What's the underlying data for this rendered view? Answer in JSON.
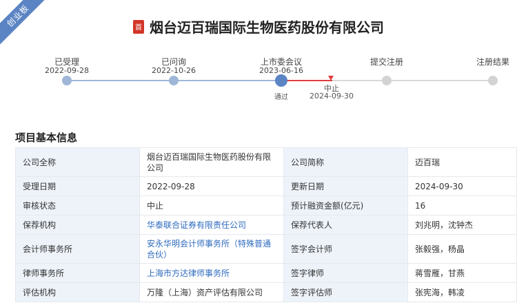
{
  "ribbon": "创业板",
  "header": {
    "badge": "首",
    "company_name": "烟台迈百瑞国际生物医药股份有限公司"
  },
  "timeline": {
    "steps": [
      {
        "label": "已受理",
        "date": "2022-09-28",
        "sub": ""
      },
      {
        "label": "已问询",
        "date": "2022-10-26",
        "sub": ""
      },
      {
        "label": "上市委会议",
        "date": "2023-06-16",
        "sub": "通过"
      },
      {
        "label": "提交注册",
        "date": "",
        "sub": ""
      },
      {
        "label": "注册结果",
        "date": "",
        "sub": ""
      }
    ],
    "stop": {
      "label": "中止",
      "date": "2024-09-30"
    }
  },
  "section": {
    "title": "项目基本信息"
  },
  "info": {
    "full_name_label": "公司全称",
    "full_name": "烟台迈百瑞国际生物医药股份有限公司",
    "short_name_label": "公司简称",
    "short_name": "迈百瑞",
    "accept_date_label": "受理日期",
    "accept_date": "2022-09-28",
    "update_date_label": "更新日期",
    "update_date": "2024-09-30",
    "status_label": "审核状态",
    "status": "中止",
    "fund_label": "预计融资金额(亿元)",
    "fund": "16",
    "sponsor_label": "保荐机构",
    "sponsor": "华泰联合证券有限责任公司",
    "sponsor_rep_label": "保荐代表人",
    "sponsor_rep": "刘兆明，沈钟杰",
    "accountant_label": "会计师事务所",
    "accountant": "安永华明会计师事务所（特殊普通合伙）",
    "sign_accountant_label": "签字会计师",
    "sign_accountant": "张毅强，杨晶",
    "law_firm_label": "律师事务所",
    "law_firm": "上海市方达律师事务所",
    "sign_lawyer_label": "签字律师",
    "sign_lawyer": "蒋雪雁，甘燕",
    "appraiser_label": "评估机构",
    "appraiser": "万隆（上海）资产评估有限公司",
    "sign_appraiser_label": "签字评估师",
    "sign_appraiser": "张宪海，韩凌"
  }
}
